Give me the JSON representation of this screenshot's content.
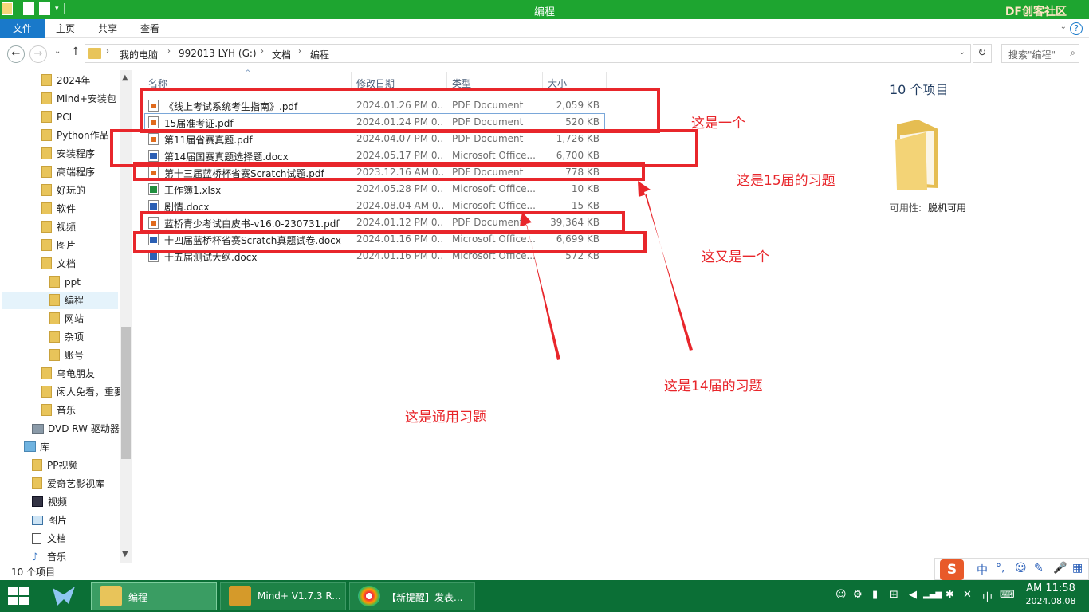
{
  "window": {
    "title": "编程",
    "brand": "DF创客社区"
  },
  "ribbon": {
    "tabs": [
      "文件",
      "主页",
      "共享",
      "查看"
    ],
    "help": "?",
    "collapse": "⌄"
  },
  "address": {
    "crumbs": [
      "我的电脑",
      "992013 LYH (G:)",
      "文档",
      "编程"
    ],
    "search_placeholder": "搜索\"编程\"",
    "back": "←",
    "forward": "→",
    "recent": "⌄",
    "up": "↑",
    "refresh": "↻",
    "dropdown": "⌄",
    "search_icon": "⌕"
  },
  "nav": {
    "items": [
      {
        "label": "2024年",
        "icon": "folder-icon"
      },
      {
        "label": "Mind+安装包",
        "icon": "folder-icon"
      },
      {
        "label": "PCL",
        "icon": "folder-icon"
      },
      {
        "label": "Python作品",
        "icon": "folder-icon"
      },
      {
        "label": "安装程序",
        "icon": "folder-icon"
      },
      {
        "label": "高端程序",
        "icon": "folder-icon"
      },
      {
        "label": "好玩的",
        "icon": "folder-icon"
      },
      {
        "label": "软件",
        "icon": "folder-icon"
      },
      {
        "label": "视频",
        "icon": "folder-icon"
      },
      {
        "label": "图片",
        "icon": "folder-icon"
      },
      {
        "label": "文档",
        "icon": "folder-icon"
      },
      {
        "label": "ppt",
        "icon": "folder-icon"
      },
      {
        "label": "编程",
        "icon": "folder-icon"
      },
      {
        "label": "网站",
        "icon": "folder-icon"
      },
      {
        "label": "杂项",
        "icon": "folder-icon"
      },
      {
        "label": "账号",
        "icon": "folder-icon"
      },
      {
        "label": "乌龟朋友",
        "icon": "folder-icon"
      },
      {
        "label": "闲人免看，重要",
        "icon": "folder-icon"
      },
      {
        "label": "音乐",
        "icon": "folder-icon"
      },
      {
        "label": "DVD RW 驱动器",
        "icon": "drive-icon"
      },
      {
        "label": "库",
        "icon": "library-icon"
      },
      {
        "label": "PP视频",
        "icon": "folder-icon"
      },
      {
        "label": "爱奇艺影视库",
        "icon": "folder-icon"
      },
      {
        "label": "视频",
        "icon": "video-library-icon"
      },
      {
        "label": "图片",
        "icon": "picture-library-icon"
      },
      {
        "label": "文档",
        "icon": "document-library-icon"
      },
      {
        "label": "音乐",
        "icon": "music-library-icon"
      }
    ],
    "selected": "编程",
    "scroll_up": "▲",
    "scroll_down": "▼"
  },
  "columns": {
    "name": "名称",
    "date": "修改日期",
    "type": "类型",
    "size": "大小",
    "sort_arrow": "^"
  },
  "files": [
    {
      "name": "《线上考试系统考生指南》.pdf",
      "date": "2024.01.26 PM 0...",
      "type": "PDF Document",
      "size": "2,059 KB",
      "icon": "pdf-icon"
    },
    {
      "name": "15届准考证.pdf",
      "date": "2024.01.24 PM 0...",
      "type": "PDF Document",
      "size": "520 KB",
      "icon": "pdf-icon"
    },
    {
      "name": "第11届省赛真题.pdf",
      "date": "2024.04.07 PM 0...",
      "type": "PDF Document",
      "size": "1,726 KB",
      "icon": "pdf-icon"
    },
    {
      "name": "第14届国赛真题选择题.docx",
      "date": "2024.05.17 PM 0...",
      "type": "Microsoft Office...",
      "size": "6,700 KB",
      "icon": "word-icon"
    },
    {
      "name": "第十三届蓝桥杯省赛Scratch试题.pdf",
      "date": "2023.12.16 AM 0...",
      "type": "PDF Document",
      "size": "778 KB",
      "icon": "pdf-icon"
    },
    {
      "name": "工作簿1.xlsx",
      "date": "2024.05.28 PM 0...",
      "type": "Microsoft Office...",
      "size": "10 KB",
      "icon": "excel-icon"
    },
    {
      "name": "剧情.docx",
      "date": "2024.08.04 AM 0...",
      "type": "Microsoft Office...",
      "size": "15 KB",
      "icon": "word-icon"
    },
    {
      "name": "蓝桥青少考试白皮书-v16.0-230731.pdf",
      "date": "2024.01.12 PM 0...",
      "type": "PDF Document",
      "size": "39,364 KB",
      "icon": "pdf-icon"
    },
    {
      "name": "十四届蓝桥杯省赛Scratch真题试卷.docx",
      "date": "2024.01.16 PM 0...",
      "type": "Microsoft Office...",
      "size": "6,699 KB",
      "icon": "word-icon"
    },
    {
      "name": "十五届测试大纲.docx",
      "date": "2024.01.16 PM 0...",
      "type": "Microsoft Office...",
      "size": "572 KB",
      "icon": "word-icon"
    }
  ],
  "annotations": {
    "texts": [
      "这是一个",
      "这是15届的习题",
      "这又是一个",
      "这是14届的习题",
      "这是通用习题"
    ],
    "color": "#e8262b"
  },
  "preview": {
    "count": "10 个项目",
    "avail_label": "可用性:",
    "avail_value": "脱机可用"
  },
  "status": {
    "count": "10 个项目"
  },
  "ime": {
    "logo": "S",
    "mode": "中",
    "punct": "°,",
    "emoji": "☺",
    "skin": "✎",
    "mic": "🎤",
    "grid": "▦"
  },
  "taskbar": {
    "tasks": [
      {
        "label": "编程",
        "icon": "folder-icon",
        "active": true
      },
      {
        "label": "Mind+ V1.7.3 R...",
        "icon": "mindplus-icon",
        "active": false
      },
      {
        "label": "【新提醒】发表...",
        "icon": "browser-icon",
        "active": false
      }
    ],
    "tray": [
      "☺",
      "⚙",
      "▮",
      "⊞",
      "◀",
      "▂▄▆",
      "✱",
      "✕",
      "中",
      "⌨"
    ],
    "time": "AM 11:58",
    "date": "2024.08.08"
  }
}
